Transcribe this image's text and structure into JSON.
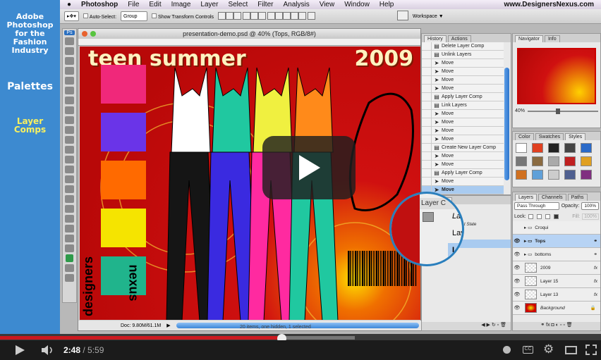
{
  "sidebar": {
    "title": "Adobe Photoshop for the Fashion Industry",
    "section": "Palettes",
    "subsection": "Layer Comps"
  },
  "menu": {
    "app": "Photoshop",
    "items": [
      "File",
      "Edit",
      "Image",
      "Layer",
      "Select",
      "Filter",
      "Analysis",
      "View",
      "Window",
      "Help"
    ],
    "site": "www.DesignersNexus.com"
  },
  "options": {
    "auto_select": "Auto-Select:",
    "auto_select_value": "Group",
    "show_transform": "Show Transform Controls",
    "workspace": "Workspace ▼"
  },
  "document": {
    "title": "presentation-demo.psd @ 40% (Tops, RGB/8#)",
    "zoom": "40%",
    "doc_size": "Doc: 9.80M/61.1M",
    "canvas_title": "teen summer",
    "canvas_year": "2009",
    "brand_a": "designers",
    "brand_b": "nexus",
    "colors": [
      "#f0287a",
      "#6a34e8",
      "#ff6a00",
      "#f5e400",
      "#20b48c"
    ]
  },
  "history": {
    "tabs": [
      "History",
      "Actions"
    ],
    "items": [
      "Delete Layer Comp",
      "Unlink Layers",
      "Move",
      "Move",
      "Move",
      "Move",
      "Apply Layer Comp",
      "Link Layers",
      "Move",
      "Move",
      "Move",
      "Move",
      "Create New Layer Comp",
      "Move",
      "Move",
      "Apply Layer Comp",
      "Move",
      "Move"
    ],
    "selected_index": 17
  },
  "layer_comps": {
    "title": "Layer C",
    "rows": [
      "Las",
      "Laye",
      "Lay"
    ],
    "last_state": "t State",
    "status": "20 items, one hidden, 1 selected"
  },
  "navigator": {
    "tabs": [
      "Navigator",
      "Info"
    ],
    "zoom": "40%"
  },
  "styles": {
    "tabs": [
      "Color",
      "Swatches",
      "Styles"
    ]
  },
  "layers": {
    "tabs": [
      "Layers",
      "Channels",
      "Paths"
    ],
    "blend": "Pass Through",
    "opacity_label": "Opacity:",
    "opacity": "100%",
    "lock_label": "Lock:",
    "fill_label": "Fill:",
    "fill": "100%",
    "items": [
      {
        "name": "Croqui",
        "type": "group",
        "visible": false
      },
      {
        "name": "Tops",
        "type": "group",
        "visible": true,
        "selected": true
      },
      {
        "name": "bottoms",
        "type": "group",
        "visible": true
      },
      {
        "name": "2009",
        "type": "layer",
        "visible": true,
        "fx": "fx"
      },
      {
        "name": "Layer 15",
        "type": "layer",
        "visible": true,
        "fx": "fx"
      },
      {
        "name": "Layer 13",
        "type": "layer",
        "visible": true,
        "fx": "fx"
      },
      {
        "name": "Background",
        "type": "background",
        "visible": true
      }
    ]
  },
  "player": {
    "current": "2:48",
    "separator": " / ",
    "duration": "5:59",
    "played_fraction": 0.468,
    "buffered_fraction": 0.59,
    "accent": "#cc181e"
  }
}
